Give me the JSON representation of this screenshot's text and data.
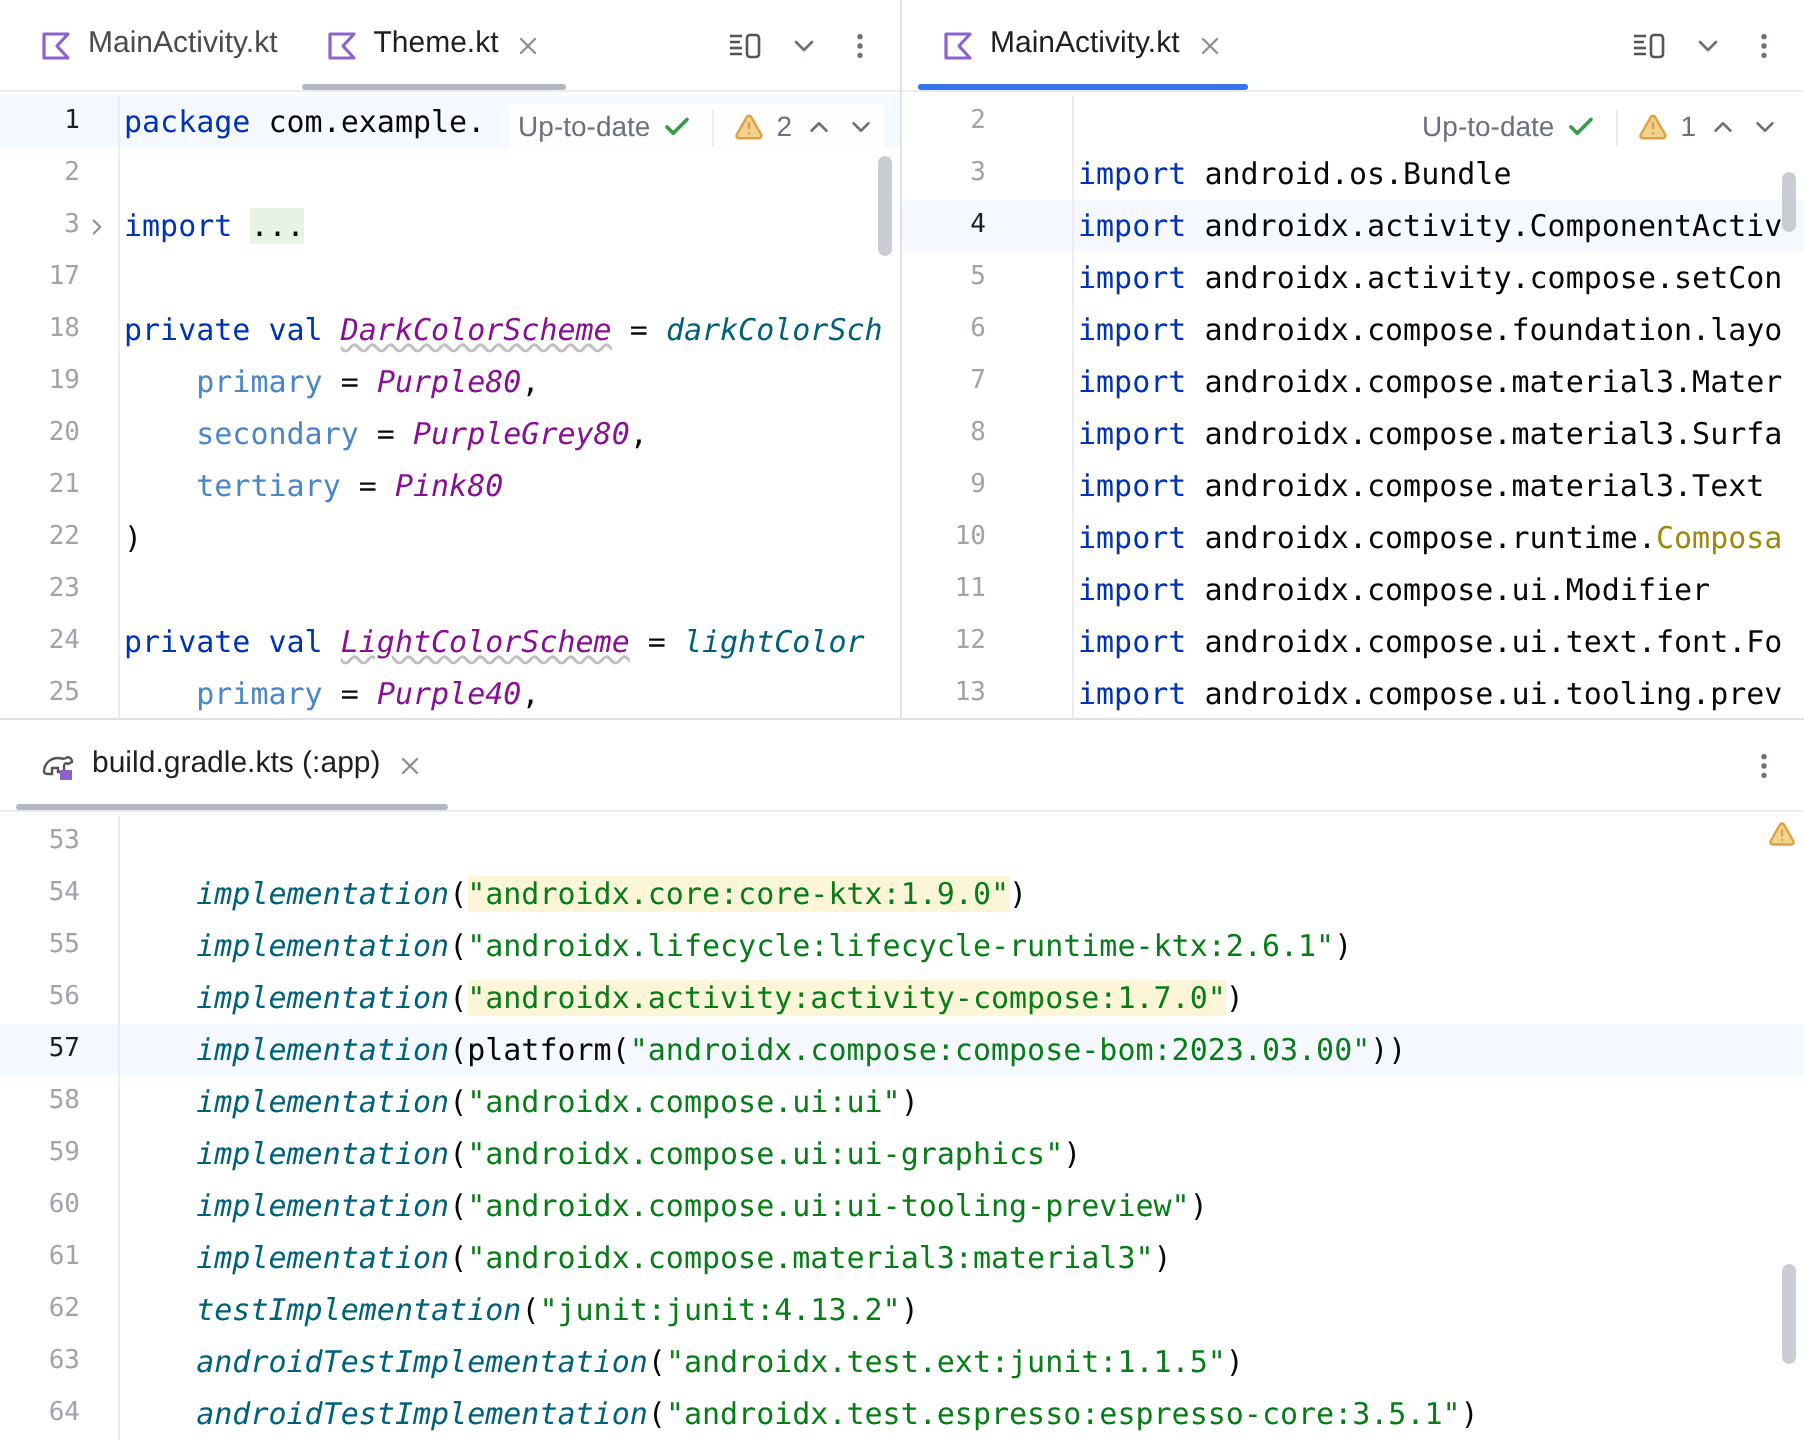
{
  "panes": [
    {
      "focused": false,
      "tabs": [
        {
          "label": "MainActivity.kt",
          "selected": false,
          "kind": "kotlin"
        },
        {
          "label": "Theme.kt",
          "selected": true,
          "kind": "kotlin"
        }
      ],
      "status": {
        "label": "Up-to-date",
        "warnings": "2"
      },
      "lines": [
        {
          "number": "1",
          "current": true,
          "fold": false,
          "tokens": [
            {
              "kind": "keyword",
              "text": "package"
            },
            {
              "kind": "plain",
              "text": " com.example."
            }
          ]
        },
        {
          "number": "2",
          "current": false,
          "fold": false
        },
        {
          "number": "3",
          "current": false,
          "fold": true,
          "tokens": [
            {
              "kind": "keyword",
              "text": "import "
            },
            {
              "kind": "folded",
              "text": "..."
            }
          ]
        },
        {
          "number": "17",
          "current": false,
          "fold": false
        },
        {
          "number": "18",
          "current": false,
          "fold": false,
          "tokens": [
            {
              "kind": "keyword",
              "text": "private val "
            },
            {
              "kind": "unused",
              "text": "DarkColorScheme"
            },
            {
              "kind": "plain",
              "text": " = "
            },
            {
              "kind": "function",
              "text": "darkColorSch"
            }
          ]
        },
        {
          "number": "19",
          "current": false,
          "fold": false,
          "tokens": [
            {
              "kind": "param",
              "text": "    primary"
            },
            {
              "kind": "plain",
              "text": " = "
            },
            {
              "kind": "constant",
              "text": "Purple80"
            },
            {
              "kind": "plain",
              "text": ","
            }
          ]
        },
        {
          "number": "20",
          "current": false,
          "fold": false,
          "tokens": [
            {
              "kind": "param",
              "text": "    secondary"
            },
            {
              "kind": "plain",
              "text": " = "
            },
            {
              "kind": "constant",
              "text": "PurpleGrey80"
            },
            {
              "kind": "plain",
              "text": ","
            }
          ]
        },
        {
          "number": "21",
          "current": false,
          "fold": false,
          "tokens": [
            {
              "kind": "param",
              "text": "    tertiary"
            },
            {
              "kind": "plain",
              "text": " = "
            },
            {
              "kind": "constant",
              "text": "Pink80"
            }
          ]
        },
        {
          "number": "22",
          "current": false,
          "fold": false,
          "tokens": [
            {
              "kind": "plain",
              "text": ")"
            }
          ]
        },
        {
          "number": "23",
          "current": false,
          "fold": false
        },
        {
          "number": "24",
          "current": false,
          "fold": false,
          "tokens": [
            {
              "kind": "keyword",
              "text": "private val "
            },
            {
              "kind": "unused",
              "text": "LightColorScheme"
            },
            {
              "kind": "plain",
              "text": " = "
            },
            {
              "kind": "function",
              "text": "lightColor"
            }
          ]
        },
        {
          "number": "25",
          "current": false,
          "fold": false,
          "tokens": [
            {
              "kind": "param",
              "text": "    primary"
            },
            {
              "kind": "plain",
              "text": " = "
            },
            {
              "kind": "constant",
              "text": "Purple40"
            },
            {
              "kind": "plain",
              "text": ","
            }
          ]
        }
      ]
    },
    {
      "focused": true,
      "tabs": [
        {
          "label": "MainActivity.kt",
          "selected": true,
          "kind": "kotlin"
        }
      ],
      "status": {
        "label": "Up-to-date",
        "warnings": "1"
      },
      "lines": [
        {
          "number": "2",
          "current": false,
          "fold": false
        },
        {
          "number": "3",
          "current": false,
          "fold": false,
          "tokens": [
            {
              "kind": "keyword",
              "text": "import"
            },
            {
              "kind": "plain",
              "text": " android.os.Bundle"
            }
          ]
        },
        {
          "number": "4",
          "current": true,
          "fold": false,
          "tokens": [
            {
              "kind": "keyword",
              "text": "import"
            },
            {
              "kind": "plain",
              "text": " androidx.activity.ComponentActiv"
            }
          ]
        },
        {
          "number": "5",
          "current": false,
          "fold": false,
          "tokens": [
            {
              "kind": "keyword",
              "text": "import"
            },
            {
              "kind": "plain",
              "text": " androidx.activity.compose.setCon"
            }
          ]
        },
        {
          "number": "6",
          "current": false,
          "fold": false,
          "tokens": [
            {
              "kind": "keyword",
              "text": "import"
            },
            {
              "kind": "plain",
              "text": " androidx.compose.foundation.layo"
            }
          ]
        },
        {
          "number": "7",
          "current": false,
          "fold": false,
          "tokens": [
            {
              "kind": "keyword",
              "text": "import"
            },
            {
              "kind": "plain",
              "text": " androidx.compose.material3.Mater"
            }
          ]
        },
        {
          "number": "8",
          "current": false,
          "fold": false,
          "tokens": [
            {
              "kind": "keyword",
              "text": "import"
            },
            {
              "kind": "plain",
              "text": " androidx.compose.material3.Surfa"
            }
          ]
        },
        {
          "number": "9",
          "current": false,
          "fold": false,
          "tokens": [
            {
              "kind": "keyword",
              "text": "import"
            },
            {
              "kind": "plain",
              "text": " androidx.compose.material3.Text"
            }
          ]
        },
        {
          "number": "10",
          "current": false,
          "fold": false,
          "tokens": [
            {
              "kind": "keyword",
              "text": "import"
            },
            {
              "kind": "plain",
              "text": " androidx.compose.runtime."
            },
            {
              "kind": "annotation",
              "text": "Composa"
            }
          ]
        },
        {
          "number": "11",
          "current": false,
          "fold": false,
          "tokens": [
            {
              "kind": "keyword",
              "text": "import"
            },
            {
              "kind": "plain",
              "text": " androidx.compose.ui.Modifier"
            }
          ]
        },
        {
          "number": "12",
          "current": false,
          "fold": false,
          "tokens": [
            {
              "kind": "keyword",
              "text": "import"
            },
            {
              "kind": "plain",
              "text": " androidx.compose.ui.text.font.Fo"
            }
          ]
        },
        {
          "number": "13",
          "current": false,
          "fold": false,
          "tokens": [
            {
              "kind": "keyword",
              "text": "import"
            },
            {
              "kind": "plain",
              "text": " androidx.compose.ui.tooling.prev"
            }
          ]
        }
      ]
    },
    {
      "focused": false,
      "tabs": [
        {
          "label": "build.gradle.kts (:app)",
          "selected": true,
          "kind": "gradle"
        }
      ],
      "lines": [
        {
          "number": "53",
          "current": false,
          "fold": false
        },
        {
          "number": "54",
          "current": false,
          "fold": false,
          "tokens": [
            {
              "kind": "function",
              "text": "    implementation"
            },
            {
              "kind": "plain",
              "text": "("
            },
            {
              "kind": "string_marked",
              "text": "\"androidx.core:core-ktx:1.9.0\""
            },
            {
              "kind": "plain",
              "text": ")"
            }
          ]
        },
        {
          "number": "55",
          "current": false,
          "fold": false,
          "tokens": [
            {
              "kind": "function",
              "text": "    implementation"
            },
            {
              "kind": "plain",
              "text": "("
            },
            {
              "kind": "string",
              "text": "\"androidx.lifecycle:lifecycle-runtime-ktx:2.6.1\""
            },
            {
              "kind": "plain",
              "text": ")"
            }
          ]
        },
        {
          "number": "56",
          "current": false,
          "fold": false,
          "tokens": [
            {
              "kind": "function",
              "text": "    implementation"
            },
            {
              "kind": "plain",
              "text": "("
            },
            {
              "kind": "string_marked",
              "text": "\"androidx.activity:activity-compose:1.7.0\""
            },
            {
              "kind": "plain",
              "text": ")"
            }
          ]
        },
        {
          "number": "57",
          "current": true,
          "fold": false,
          "tokens": [
            {
              "kind": "function",
              "text": "    implementation"
            },
            {
              "kind": "plain",
              "text": "(platform("
            },
            {
              "kind": "string",
              "text": "\"androidx.compose:compose-bom:2023.03.00\""
            },
            {
              "kind": "plain",
              "text": "))"
            }
          ]
        },
        {
          "number": "58",
          "current": false,
          "fold": false,
          "tokens": [
            {
              "kind": "function",
              "text": "    implementation"
            },
            {
              "kind": "plain",
              "text": "("
            },
            {
              "kind": "string",
              "text": "\"androidx.compose.ui:ui\""
            },
            {
              "kind": "plain",
              "text": ")"
            }
          ]
        },
        {
          "number": "59",
          "current": false,
          "fold": false,
          "tokens": [
            {
              "kind": "function",
              "text": "    implementation"
            },
            {
              "kind": "plain",
              "text": "("
            },
            {
              "kind": "string",
              "text": "\"androidx.compose.ui:ui-graphics\""
            },
            {
              "kind": "plain",
              "text": ")"
            }
          ]
        },
        {
          "number": "60",
          "current": false,
          "fold": false,
          "tokens": [
            {
              "kind": "function",
              "text": "    implementation"
            },
            {
              "kind": "plain",
              "text": "("
            },
            {
              "kind": "string",
              "text": "\"androidx.compose.ui:ui-tooling-preview\""
            },
            {
              "kind": "plain",
              "text": ")"
            }
          ]
        },
        {
          "number": "61",
          "current": false,
          "fold": false,
          "tokens": [
            {
              "kind": "function",
              "text": "    implementation"
            },
            {
              "kind": "plain",
              "text": "("
            },
            {
              "kind": "string",
              "text": "\"androidx.compose.material3:material3\""
            },
            {
              "kind": "plain",
              "text": ")"
            }
          ]
        },
        {
          "number": "62",
          "current": false,
          "fold": false,
          "tokens": [
            {
              "kind": "function",
              "text": "    testImplementation"
            },
            {
              "kind": "plain",
              "text": "("
            },
            {
              "kind": "string",
              "text": "\"junit:junit:4.13.2\""
            },
            {
              "kind": "plain",
              "text": ")"
            }
          ]
        },
        {
          "number": "63",
          "current": false,
          "fold": false,
          "tokens": [
            {
              "kind": "function",
              "text": "    androidTestImplementation"
            },
            {
              "kind": "plain",
              "text": "("
            },
            {
              "kind": "string",
              "text": "\"androidx.test.ext:junit:1.1.5\""
            },
            {
              "kind": "plain",
              "text": ")"
            }
          ]
        },
        {
          "number": "64",
          "current": false,
          "fold": false,
          "tokens": [
            {
              "kind": "function",
              "text": "    androidTestImplementation"
            },
            {
              "kind": "plain",
              "text": "("
            },
            {
              "kind": "string",
              "text": "\"androidx.test.espresso:espresso-core:3.5.1\""
            },
            {
              "kind": "plain",
              "text": ")"
            }
          ]
        }
      ]
    }
  ]
}
